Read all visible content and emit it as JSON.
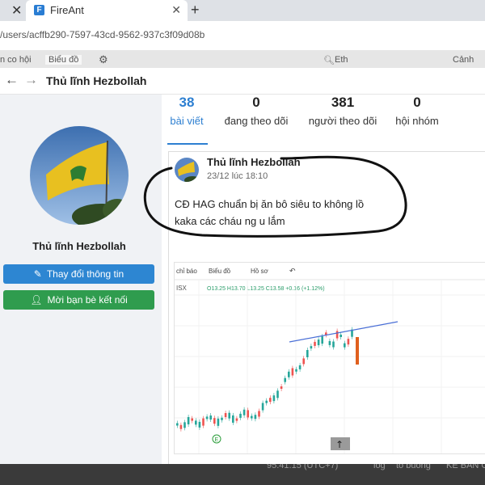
{
  "browser": {
    "tab_title": "FireAnt",
    "favicon_letter": "F",
    "url": "/users/acffb290-7597-43cd-9562-937c3f09d08b"
  },
  "background_app": {
    "items": [
      "n co hội",
      "Biểu đồ",
      "Eth",
      "Cảnh"
    ],
    "footer_items": [
      "95.41.15 (UTC+7)",
      "log",
      "to buồng",
      "KẾ BAN G"
    ]
  },
  "profile": {
    "header_title": "Thủ lĩnh Hezbollah",
    "display_name": "Thủ lĩnh Hezbollah",
    "edit_button": "Thay đổi thông tin",
    "invite_button": "Mời bạn bè kết nối",
    "stats": [
      {
        "value": "38",
        "label": "bài viết"
      },
      {
        "value": "0",
        "label": "đang theo dõi"
      },
      {
        "value": "381",
        "label": "người theo dõi"
      },
      {
        "value": "0",
        "label": "hội nhóm"
      }
    ],
    "active_stat": 0
  },
  "post": {
    "author": "Thủ lĩnh Hezbollah",
    "time": "23/12 lúc 18:10",
    "line1": "CĐ HAG chuẩn bị ăn bô siêu to không lồ",
    "line2": "kaka các cháu ng u lắm"
  },
  "chart_image": {
    "toolbar": [
      "chỉ báo",
      "Biểu đồ",
      "Hồ sơ",
      "↶"
    ],
    "symbol": "ISX",
    "ohlc": "O13.25 H13.70 L13.25 C13.58 +0.16 (+1.12%)",
    "marker": "E",
    "scroll_button": "↑"
  },
  "colors": {
    "accent_blue": "#2d7fd1",
    "edit_button": "#2d86d2",
    "invite_button": "#2f9c4e",
    "candle_up": "#26a69a",
    "candle_down": "#ef5350",
    "trendline": "#4a6fd6"
  },
  "icons": {
    "edit": "pencil-icon",
    "invite": "add-person-icon",
    "back": "back-arrow-icon",
    "forward": "forward-arrow-icon"
  }
}
